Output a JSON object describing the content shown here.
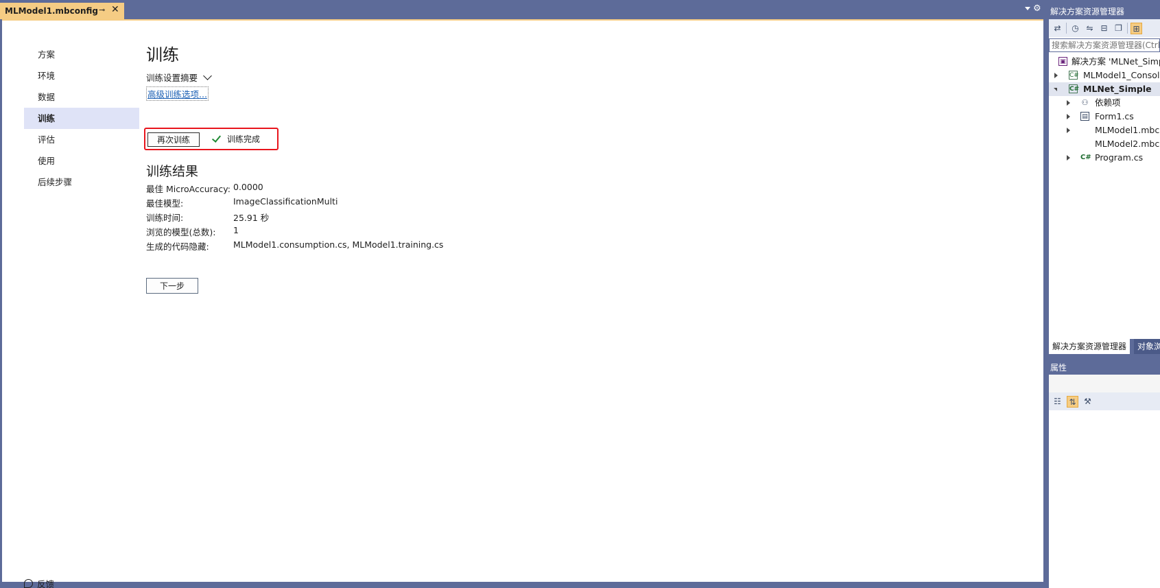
{
  "document_tab": {
    "title": "MLModel1.mbconfig",
    "pin_glyph": "⊸",
    "close_glyph": "✕"
  },
  "nav": {
    "items": [
      {
        "label": "方案"
      },
      {
        "label": "环境"
      },
      {
        "label": "数据"
      },
      {
        "label": "训练",
        "active": true
      },
      {
        "label": "评估"
      },
      {
        "label": "使用"
      },
      {
        "label": "后续步骤"
      }
    ]
  },
  "main": {
    "title": "训练",
    "summary_label": "训练设置摘要",
    "advanced_link": "高级训练选项...",
    "retrain_button": "再次训练",
    "status_text": "训练完成",
    "results_title": "训练结果",
    "results": [
      {
        "label": "最佳 MicroAccuracy:",
        "value": "0.0000"
      },
      {
        "label": "最佳模型:",
        "value": "ImageClassificationMulti"
      },
      {
        "label": "训练时间:",
        "value": "25.91 秒"
      },
      {
        "label": "浏览的模型(总数):",
        "value": "1"
      },
      {
        "label": "生成的代码隐藏:",
        "value": "MLModel1.consumption.cs, MLModel1.training.cs"
      }
    ],
    "next_button": "下一步"
  },
  "feedback": {
    "label": "反馈"
  },
  "solution_explorer": {
    "header": "解决方案资源管理器",
    "search_placeholder": "搜索解决方案资源管理器(Ctrl",
    "tree": [
      {
        "label": "解决方案 'MLNet_Simp",
        "indent": 0,
        "icon": "solution-icon",
        "expander": "none"
      },
      {
        "label": "MLModel1_Consol",
        "indent": 1,
        "icon": "csharp-project-icon",
        "expander": "collapsed"
      },
      {
        "label": "MLNet_Simple",
        "indent": 1,
        "icon": "csharp-project-icon",
        "expander": "expanded",
        "bold": true
      },
      {
        "label": "依赖项",
        "indent": 2,
        "icon": "dependencies-icon",
        "expander": "collapsed"
      },
      {
        "label": "Form1.cs",
        "indent": 2,
        "icon": "form-icon",
        "expander": "collapsed"
      },
      {
        "label": "MLModel1.mbc",
        "indent": 2,
        "icon": "none",
        "expander": "collapsed"
      },
      {
        "label": "MLModel2.mbc",
        "indent": 2,
        "icon": "none",
        "expander": "none"
      },
      {
        "label": "Program.cs",
        "indent": 2,
        "icon": "csharp-file-icon",
        "expander": "collapsed"
      }
    ],
    "tab_active": "解决方案资源管理器",
    "tab_inactive": "对象浏"
  },
  "properties": {
    "header": "属性"
  },
  "colors": {
    "accent_tab": "#f5cc84",
    "chrome": "#5d6b99",
    "highlight_box": "#e8141c",
    "check_green": "#1e8a33",
    "link": "#1a5fb4"
  }
}
